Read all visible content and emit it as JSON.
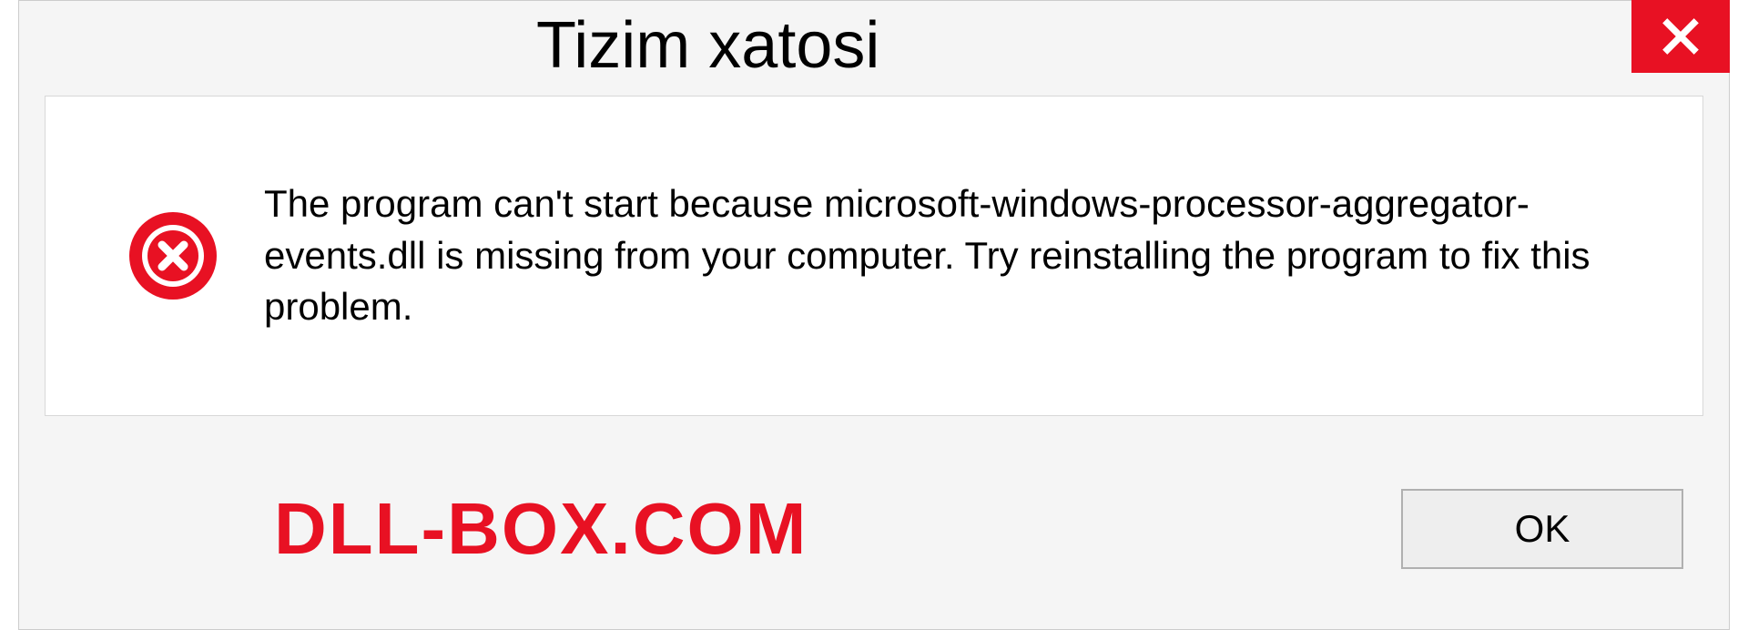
{
  "dialog": {
    "title": "Tizim xatosi",
    "message": "The program can't start because microsoft-windows-processor-aggregator-events.dll is missing from your computer. Try reinstalling the program to fix this problem.",
    "ok_label": "OK"
  },
  "watermark": "DLL-BOX.COM"
}
